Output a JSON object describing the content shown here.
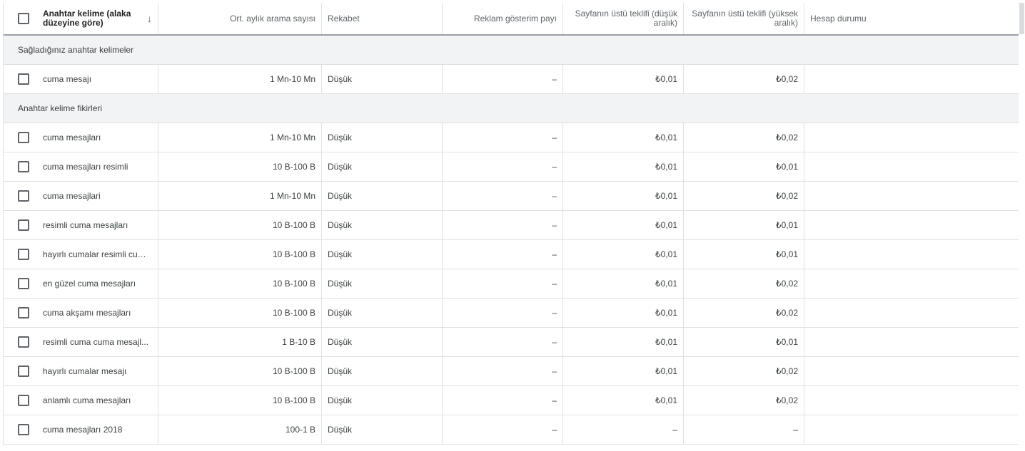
{
  "header": {
    "keyword": "Anahtar kelime (alaka düzeyine göre)",
    "avg_searches": "Ort. aylık arama sayısı",
    "competition": "Rekabet",
    "impression_share": "Reklam gösterim payı",
    "bid_low": "Sayfanın üstü teklifi (düşük aralık)",
    "bid_high": "Sayfanın üstü teklifi (yüksek aralık)",
    "account_status": "Hesap durumu",
    "sort_icon": "arrow-down-icon"
  },
  "sections": [
    {
      "label": "Sağladığınız anahtar kelimeler",
      "rows": [
        {
          "keyword": "cuma mesajı",
          "avg": "1 Mn-10 Mn",
          "competition": "Düşük",
          "impression": "–",
          "low": "₺0,01",
          "high": "₺0,02",
          "status": ""
        }
      ]
    },
    {
      "label": "Anahtar kelime fikirleri",
      "rows": [
        {
          "keyword": "cuma mesajları",
          "avg": "1 Mn-10 Mn",
          "competition": "Düşük",
          "impression": "–",
          "low": "₺0,01",
          "high": "₺0,02",
          "status": ""
        },
        {
          "keyword": "cuma mesajları resimli",
          "avg": "10 B-100 B",
          "competition": "Düşük",
          "impression": "–",
          "low": "₺0,01",
          "high": "₺0,01",
          "status": ""
        },
        {
          "keyword": "cuma mesajlari",
          "avg": "1 Mn-10 Mn",
          "competition": "Düşük",
          "impression": "–",
          "low": "₺0,01",
          "high": "₺0,02",
          "status": ""
        },
        {
          "keyword": "resimli cuma mesajları",
          "avg": "10 B-100 B",
          "competition": "Düşük",
          "impression": "–",
          "low": "₺0,01",
          "high": "₺0,01",
          "status": ""
        },
        {
          "keyword": "hayırlı cumalar resimli cum...",
          "avg": "10 B-100 B",
          "competition": "Düşük",
          "impression": "–",
          "low": "₺0,01",
          "high": "₺0,01",
          "status": ""
        },
        {
          "keyword": "en güzel cuma mesajları",
          "avg": "10 B-100 B",
          "competition": "Düşük",
          "impression": "–",
          "low": "₺0,01",
          "high": "₺0,02",
          "status": ""
        },
        {
          "keyword": "cuma akşamı mesajları",
          "avg": "10 B-100 B",
          "competition": "Düşük",
          "impression": "–",
          "low": "₺0,01",
          "high": "₺0,02",
          "status": ""
        },
        {
          "keyword": "resimli cuma cuma mesajl...",
          "avg": "1 B-10 B",
          "competition": "Düşük",
          "impression": "–",
          "low": "₺0,01",
          "high": "₺0,01",
          "status": ""
        },
        {
          "keyword": "hayırlı cumalar mesajı",
          "avg": "10 B-100 B",
          "competition": "Düşük",
          "impression": "–",
          "low": "₺0,01",
          "high": "₺0,02",
          "status": ""
        },
        {
          "keyword": "anlamlı cuma mesajları",
          "avg": "10 B-100 B",
          "competition": "Düşük",
          "impression": "–",
          "low": "₺0,01",
          "high": "₺0,02",
          "status": ""
        },
        {
          "keyword": "cuma mesajları 2018",
          "avg": "100-1 B",
          "competition": "Düşük",
          "impression": "–",
          "low": "–",
          "high": "–",
          "status": ""
        }
      ]
    }
  ]
}
